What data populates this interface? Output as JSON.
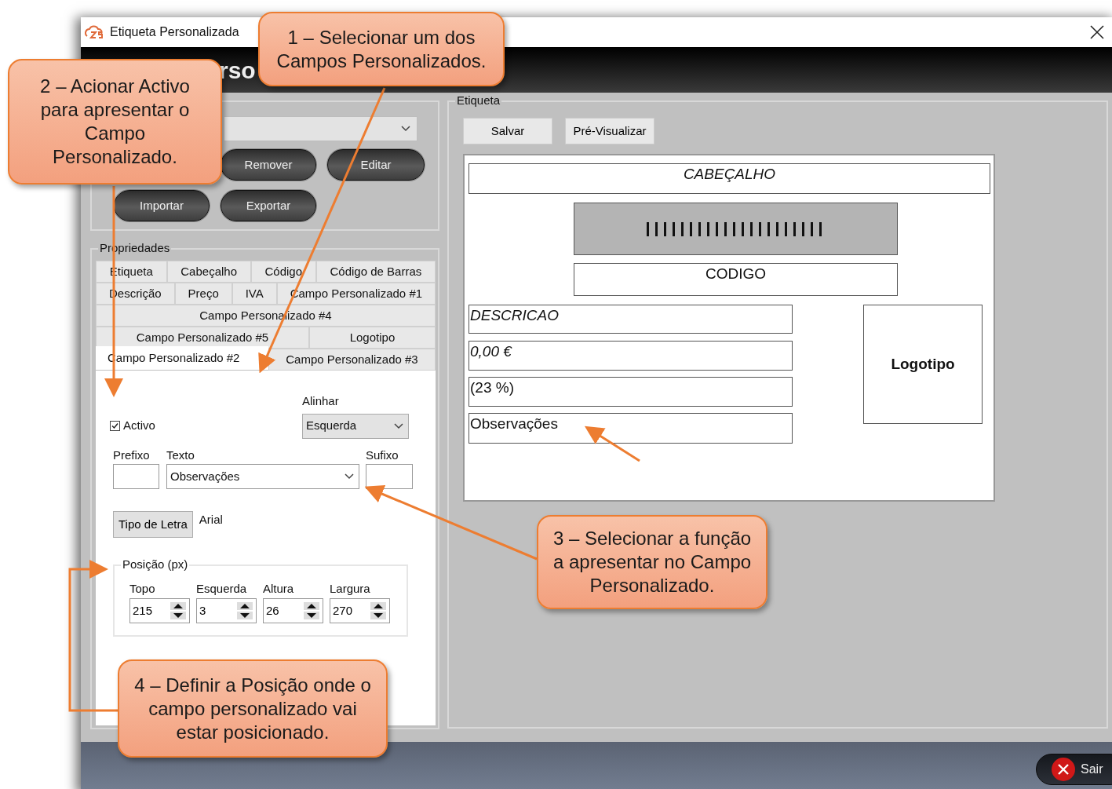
{
  "window": {
    "title": "Etiqueta Personalizada"
  },
  "header": {
    "title": "rso"
  },
  "template_buttons": [
    "Remover",
    "Editar",
    "Importar",
    "Exportar"
  ],
  "properties": {
    "title": "Propriedades",
    "tab_rows": [
      [
        {
          "label": "Etiqueta",
          "selected": false
        },
        {
          "label": "Cabeçalho",
          "selected": false
        },
        {
          "label": "Código",
          "selected": false
        },
        {
          "label": "Código de Barras",
          "selected": false
        }
      ],
      [
        {
          "label": "Descrição",
          "selected": false
        },
        {
          "label": "Preço",
          "selected": false
        },
        {
          "label": "IVA",
          "selected": false
        },
        {
          "label": "Campo Personalizado #1",
          "selected": false
        }
      ],
      [
        {
          "label": "Campo Personalizado #4",
          "selected": false
        }
      ],
      [
        {
          "label": "Campo Personalizado #5",
          "selected": false
        },
        {
          "label": "Logotipo",
          "selected": false
        }
      ],
      [
        {
          "label": "Campo Personalizado #2",
          "selected": true
        },
        {
          "label": "Campo Personalizado #3",
          "selected": false
        }
      ]
    ],
    "active": {
      "label": "Activo",
      "checked": true
    },
    "align": {
      "label": "Alinhar",
      "value": "Esquerda"
    },
    "prefix": {
      "label": "Prefixo"
    },
    "text": {
      "label": "Texto",
      "value": "Observações"
    },
    "suffix": {
      "label": "Sufixo"
    },
    "font_button": "Tipo de Letra",
    "font_name": "Arial",
    "position": {
      "title": "Posição (px)",
      "fields": [
        {
          "label": "Topo",
          "value": "215"
        },
        {
          "label": "Esquerda",
          "value": "3"
        },
        {
          "label": "Altura",
          "value": "26"
        },
        {
          "label": "Largura",
          "value": "270"
        }
      ]
    }
  },
  "label": {
    "title": "Etiqueta",
    "buttons": [
      "Salvar",
      "Pré-Visualizar"
    ],
    "elements": [
      {
        "kind": "text",
        "text": "CABEÇALHO",
        "italic": true
      },
      {
        "kind": "barcode"
      },
      {
        "kind": "text",
        "text": "CODIGO",
        "italic": false
      },
      {
        "kind": "text",
        "text": "DESCRICAO",
        "italic": true
      },
      {
        "kind": "text",
        "text": "0,00 €",
        "italic": true
      },
      {
        "kind": "text",
        "text": "(23 %)",
        "italic": false
      },
      {
        "kind": "text",
        "text": "Observações",
        "italic": false
      },
      {
        "kind": "logo",
        "text": "Logotipo"
      }
    ]
  },
  "footer": {
    "exit": "Sair"
  },
  "callouts": [
    "1 – Selecionar um dos Campos Personalizados.",
    "2 – Acionar Activo para apresentar o Campo Personalizado.",
    "3 – Selecionar a função a apresentar no Campo Personalizado.",
    "4 – Definir a Posição onde o campo personalizado vai estar posicionado."
  ]
}
